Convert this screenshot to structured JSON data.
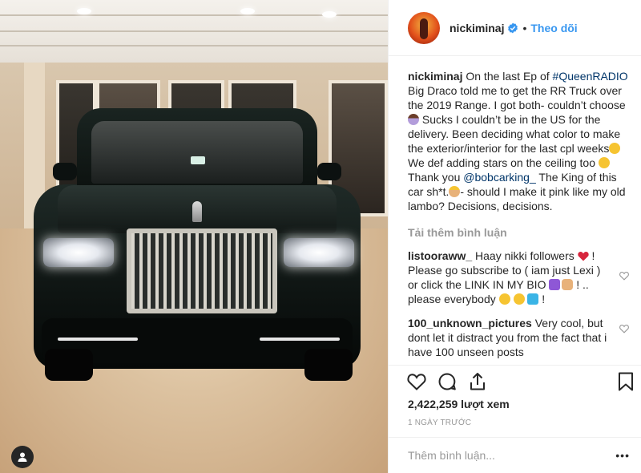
{
  "post": {
    "username": "nickiminaj",
    "follow_label": "Theo dõi",
    "separator": "•"
  },
  "caption": {
    "username": "nickiminaj",
    "text_1": "On the last Ep of ",
    "hashtag": "#QueenRADIO",
    "text_2": " Big Draco told me to get the RR Truck over the 2019 Range. I got both- couldn’t choose ",
    "text_3": " Sucks I couldn’t be in the US for the delivery. Been deciding what color to make the exterior/interior for the last cpl weeks",
    "text_4": " We def adding stars on the ceiling too ",
    "text_5": " Thank you ",
    "mention": "@bobcarking_",
    "text_6": " The King of this car sh*t.",
    "text_7": "- should I make it pink like my old lambo? Decisions, decisions."
  },
  "load_more_label": "Tải thêm bình luận",
  "comments": [
    {
      "username": "listooraww_",
      "text_1": " Haay nikki followers ",
      "text_2": " ! Please go subscribe to ( iam just Lexi ) or click the LINK IN MY BIO ",
      "text_3": " ! .. please everybody ",
      "text_4": " !"
    },
    {
      "username": "100_unknown_pictures",
      "text_1": " Very cool, but dont let it distract you from the fact that i have 100 unseen posts"
    }
  ],
  "stats": {
    "views": "2,422,259 lượt xem",
    "time": "1 NGÀY TRƯỚC"
  },
  "add_comment": {
    "placeholder": "Thêm bình luận...",
    "more": "•••"
  },
  "colors": {
    "accent": "#3897f0",
    "link": "#003569",
    "muted": "#999999"
  },
  "icons": [
    "verified-badge-icon",
    "heart-icon",
    "comment-icon",
    "share-icon",
    "bookmark-icon",
    "user-tag-icon",
    "heart-small-icon"
  ]
}
